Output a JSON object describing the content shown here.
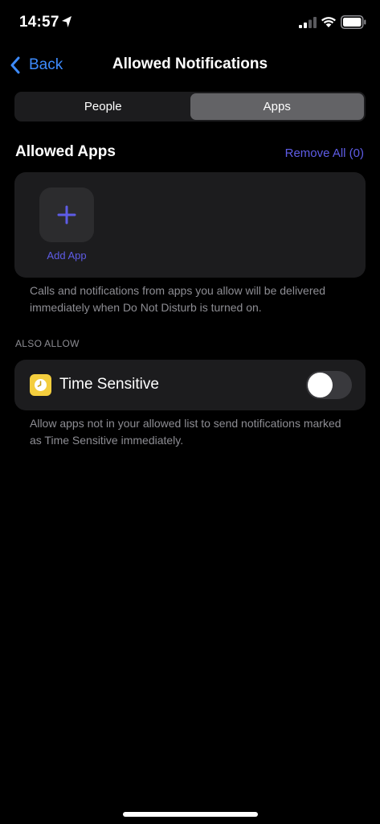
{
  "status_bar": {
    "time": "14:57",
    "icons": [
      "location-arrow-icon",
      "cellular-signal-icon",
      "wifi-icon",
      "battery-icon"
    ]
  },
  "nav": {
    "back_label": "Back",
    "title": "Allowed Notifications"
  },
  "segmented_control": {
    "segments": [
      {
        "label": "People",
        "selected": false
      },
      {
        "label": "Apps",
        "selected": true
      }
    ]
  },
  "allowed_apps": {
    "title": "Allowed Apps",
    "remove_all_label": "Remove All (0)",
    "add_app_label": "Add App",
    "footnote": "Calls and notifications from apps you allow will be delivered immediately when Do Not Disturb is turned on."
  },
  "also_allow": {
    "header": "ALSO ALLOW",
    "time_sensitive": {
      "label": "Time Sensitive",
      "enabled": false,
      "icon": "clock-icon"
    },
    "footnote": "Allow apps not in your allowed list to send notifications marked as Time Sensitive immediately."
  },
  "colors": {
    "background": "#000000",
    "card": "#1c1c1e",
    "accent_blue": "#3d8bfd",
    "accent_indigo": "#5e5ce6",
    "secondary_text": "#8d8d93",
    "time_sensitive_yellow": "#f4ce3e"
  }
}
